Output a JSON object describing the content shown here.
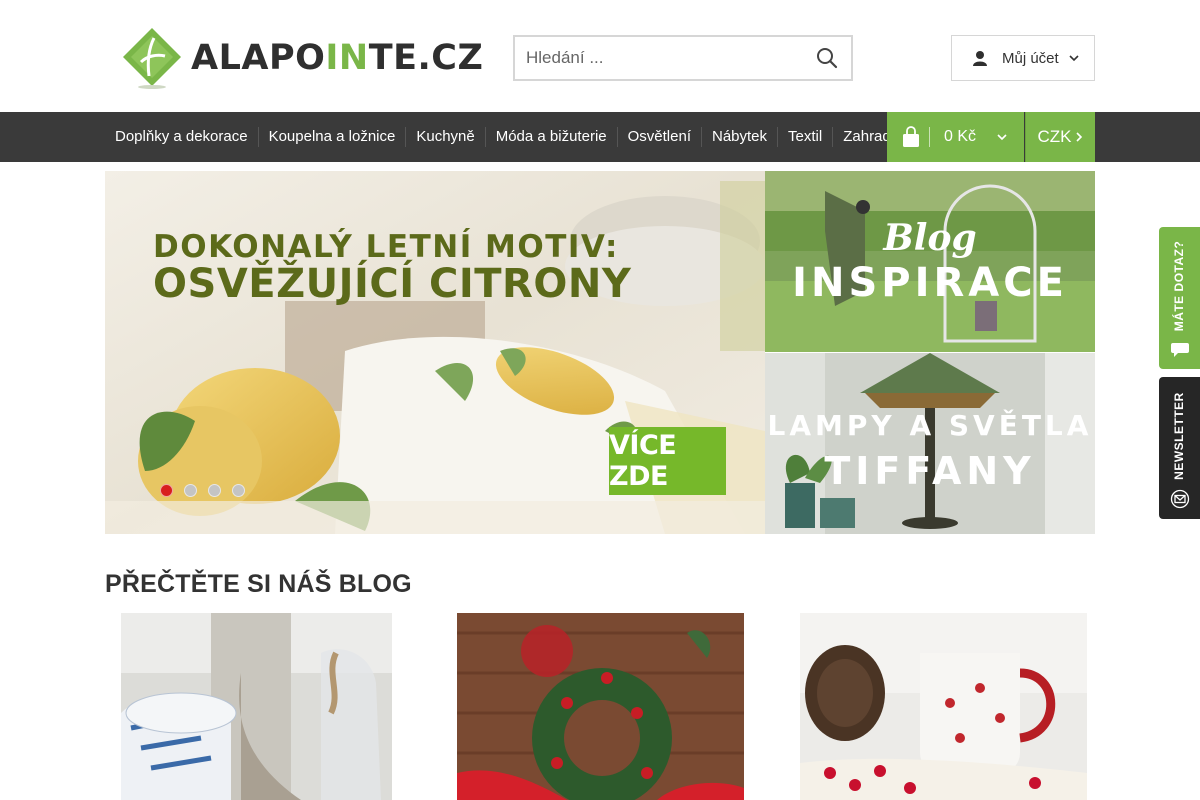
{
  "brand": {
    "logo_text_part1": "ALAPO",
    "logo_text_accent": "IN",
    "logo_text_part2": "TE.CZ",
    "accent_color": "#7ab648"
  },
  "search": {
    "placeholder": "Hledání ..."
  },
  "account": {
    "label": "Můj účet"
  },
  "nav": {
    "items": [
      {
        "label": "Doplňky a dekorace"
      },
      {
        "label": "Koupelna a ložnice"
      },
      {
        "label": "Kuchyně"
      },
      {
        "label": "Móda a bižuterie"
      },
      {
        "label": "Osvětlení"
      },
      {
        "label": "Nábytek"
      },
      {
        "label": "Textil"
      },
      {
        "label": "Zahrada a zvířata"
      }
    ]
  },
  "cart": {
    "amount": "0 Kč"
  },
  "currency": {
    "label": "CZK"
  },
  "hero": {
    "title_line1": "DOKONALÝ LETNÍ MOTIV:",
    "title_line2": "OSVĚŽUJÍCÍ CITRONY",
    "cta": "VÍCE ZDE",
    "slides_count": 4,
    "active_slide": 1
  },
  "banners": {
    "blog": {
      "script": "Blog",
      "title": "INSPIRACE"
    },
    "lamps": {
      "line1": "LAMPY A SVĚTLA",
      "line2": "TIFFANY"
    }
  },
  "side_tabs": {
    "question": "MÁTE DOTAZ?",
    "newsletter": "NEWSLETTER"
  },
  "blog": {
    "heading": "PŘEČTĚTE SI NÁŠ BLOG"
  },
  "icons": [
    "logo-icon",
    "search-icon",
    "user-icon",
    "chevron-down-icon",
    "shopping-bag-icon",
    "chevron-right-icon",
    "chat-icon",
    "mail-icon"
  ]
}
